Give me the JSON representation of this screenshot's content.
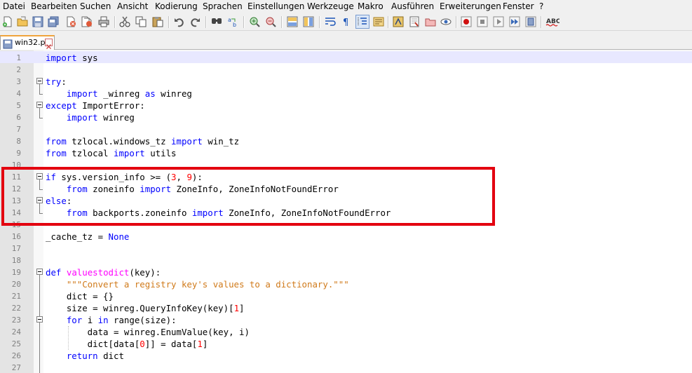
{
  "menu": [
    {
      "label": "Datei"
    },
    {
      "label": "Bearbeiten"
    },
    {
      "label": "Suchen"
    },
    {
      "label": "Ansicht"
    },
    {
      "label": "Kodierung"
    },
    {
      "label": "Sprachen"
    },
    {
      "label": "Einstellungen"
    },
    {
      "label": "Werkzeuge"
    },
    {
      "label": "Makro"
    },
    {
      "label": "Ausführen"
    },
    {
      "label": "Erweiterungen"
    },
    {
      "label": "Fenster"
    },
    {
      "label": "?"
    }
  ],
  "toolbar": {
    "spellcheck_label": "ABC",
    "icons": [
      "new-file-icon",
      "open-file-icon",
      "save-icon",
      "save-all-icon",
      "close-icon",
      "close-all-icon",
      "print-icon",
      "cut-icon",
      "copy-icon",
      "paste-icon",
      "undo-icon",
      "redo-icon",
      "find-icon",
      "replace-icon",
      "zoom-in-icon",
      "zoom-out-icon",
      "sync-vertical-icon",
      "sync-horizontal-icon",
      "word-wrap-icon",
      "show-all-characters-icon",
      "indent-guide-icon",
      "document-map-icon",
      "function-list-icon",
      "folder-workspace-icon",
      "monitoring-icon",
      "record-macro-icon",
      "stop-macro-icon",
      "play-macro-icon",
      "run-macro-multiple-icon",
      "save-macro-icon",
      "spellcheck-icon"
    ]
  },
  "tab": {
    "label": "win32.py"
  },
  "colors": {
    "highlight_box": "#e3000f",
    "keyword": "#0000ff",
    "number": "#ff0000",
    "string": "#808000",
    "function": "#ff00ff"
  },
  "lines": [
    {
      "n": "1"
    },
    {
      "n": "2"
    },
    {
      "n": "3"
    },
    {
      "n": "4"
    },
    {
      "n": "5"
    },
    {
      "n": "6"
    },
    {
      "n": "7"
    },
    {
      "n": "8"
    },
    {
      "n": "9"
    },
    {
      "n": "10"
    },
    {
      "n": "11"
    },
    {
      "n": "12"
    },
    {
      "n": "13"
    },
    {
      "n": "14"
    },
    {
      "n": "15"
    },
    {
      "n": "16"
    },
    {
      "n": "17"
    },
    {
      "n": "18"
    },
    {
      "n": "19"
    },
    {
      "n": "20"
    },
    {
      "n": "21"
    },
    {
      "n": "22"
    },
    {
      "n": "23"
    },
    {
      "n": "24"
    },
    {
      "n": "25"
    },
    {
      "n": "26"
    },
    {
      "n": "27"
    }
  ],
  "code": {
    "l1": [
      "import",
      " sys"
    ],
    "l3": [
      "try",
      ":"
    ],
    "l4": [
      "    ",
      "import",
      " _winreg ",
      "as",
      " winreg"
    ],
    "l5": [
      "except",
      " ImportError:"
    ],
    "l6": [
      "    ",
      "import",
      " winreg"
    ],
    "l8": [
      "from",
      " tzlocal.windows_tz ",
      "import",
      " win_tz"
    ],
    "l9": [
      "from",
      " tzlocal ",
      "import",
      " utils"
    ],
    "l11": [
      "if",
      " sys.version_info >= (",
      "3",
      ", ",
      "9",
      "):"
    ],
    "l12": [
      "    ",
      "from",
      " zoneinfo ",
      "import",
      " ZoneInfo, ZoneInfoNotFoundError"
    ],
    "l13": [
      "else",
      ":"
    ],
    "l14": [
      "    ",
      "from",
      " backports.zoneinfo ",
      "import",
      " ZoneInfo, ZoneInfoNotFoundError"
    ],
    "l16": [
      "_cache_tz = ",
      "None"
    ],
    "l19": [
      "def",
      " ",
      "valuestodict",
      "(key):"
    ],
    "l20": [
      "    ",
      "\"\"\"Convert a registry key's values to a dictionary.\"\"\""
    ],
    "l21": [
      "    dict = {}"
    ],
    "l22": [
      "    size = winreg.QueryInfoKey(key)[",
      "1",
      "]"
    ],
    "l23": [
      "    ",
      "for",
      " i ",
      "in",
      " range(size):"
    ],
    "l24": [
      "        data = winreg.EnumValue(key, i)"
    ],
    "l25": [
      "        dict[data[",
      "0",
      "]] = data[",
      "1",
      "]"
    ],
    "l26": [
      "    ",
      "return",
      " dict"
    ]
  }
}
